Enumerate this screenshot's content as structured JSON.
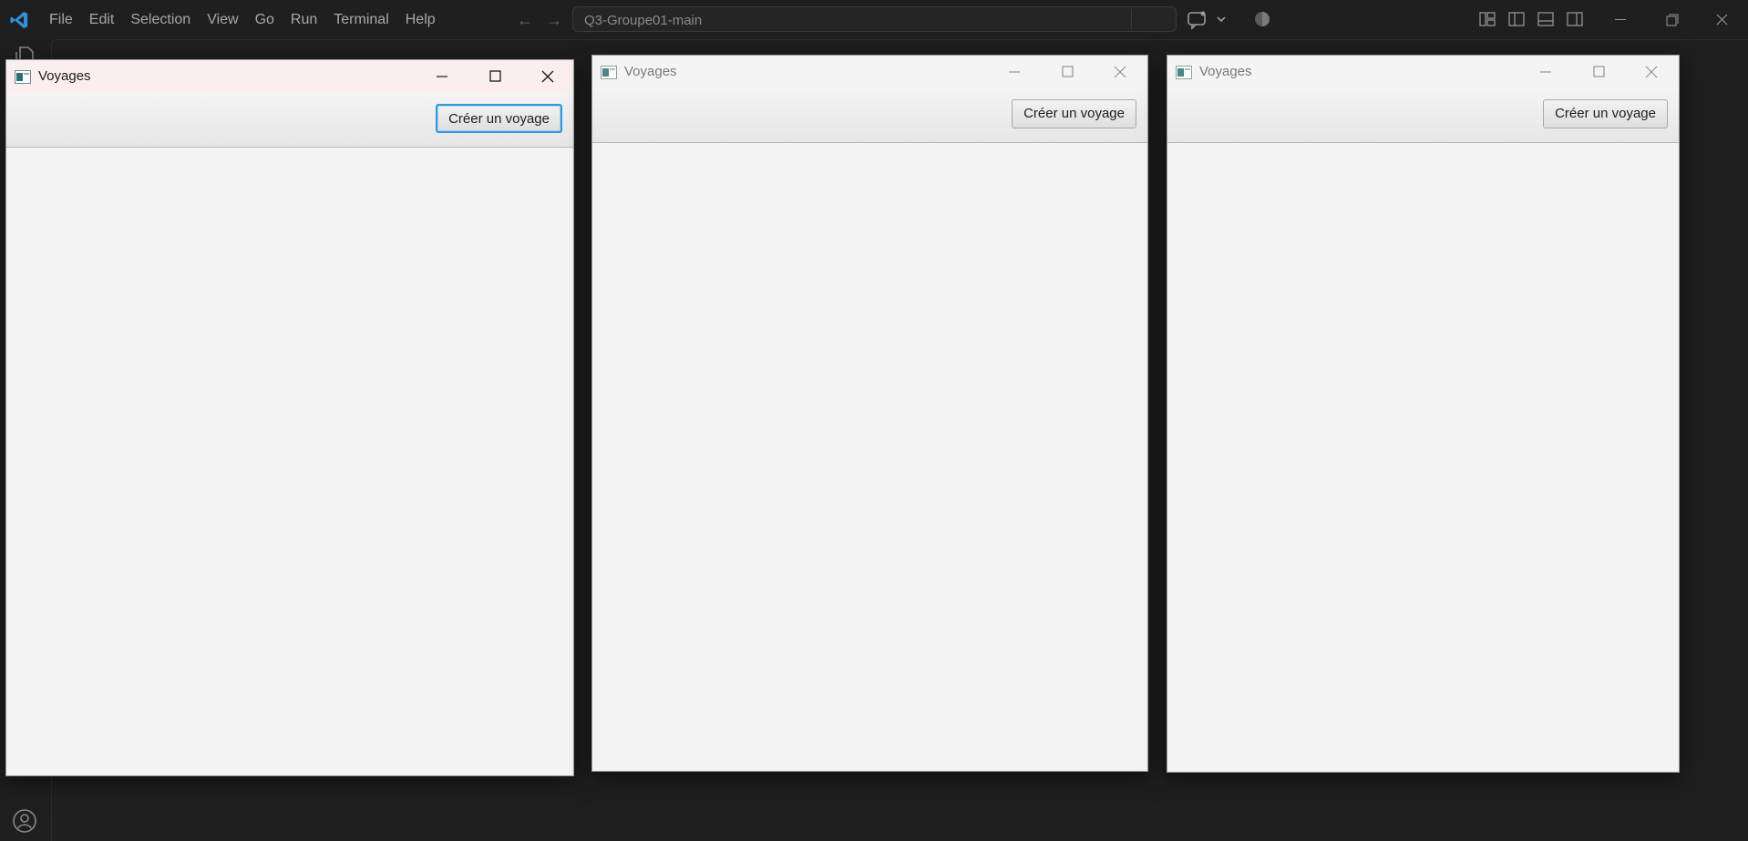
{
  "vscode": {
    "menu": [
      "File",
      "Edit",
      "Selection",
      "View",
      "Go",
      "Run",
      "Terminal",
      "Help"
    ],
    "search_text": "Q3-Groupe01-main"
  },
  "windows": [
    {
      "title": "Voyages",
      "button_label": "Créer un voyage",
      "state": "active"
    },
    {
      "title": "Voyages",
      "button_label": "Créer un voyage",
      "state": "inactive"
    },
    {
      "title": "Voyages",
      "button_label": "Créer un voyage",
      "state": "inactive"
    }
  ],
  "colors": {
    "accent_focus": "#3399d6",
    "vscode_bg": "#1f1f1f",
    "app_bg": "#f4f4f4"
  }
}
